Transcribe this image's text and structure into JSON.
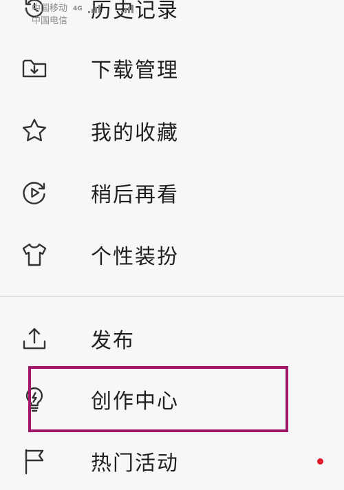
{
  "status_bar": {
    "carrier_1": "中国移动",
    "carrier_2": "中国电信",
    "network_badge": "4G"
  },
  "menu": {
    "items": [
      {
        "label": "历史记录",
        "icon": "history-icon"
      },
      {
        "label": "下载管理",
        "icon": "download-folder-icon"
      },
      {
        "label": "我的收藏",
        "icon": "star-icon"
      },
      {
        "label": "稍后再看",
        "icon": "watch-later-icon"
      },
      {
        "label": "个性装扮",
        "icon": "tshirt-icon"
      },
      {
        "label": "发布",
        "icon": "upload-icon"
      },
      {
        "label": "创作中心",
        "icon": "lightbulb-icon"
      },
      {
        "label": "热门活动",
        "icon": "flag-icon"
      }
    ]
  },
  "colors": {
    "highlight": "#a1186b",
    "background": "#f7f7f7",
    "text": "#202020",
    "icon_stroke": "#333333",
    "notification_dot": "#e01a2b"
  }
}
